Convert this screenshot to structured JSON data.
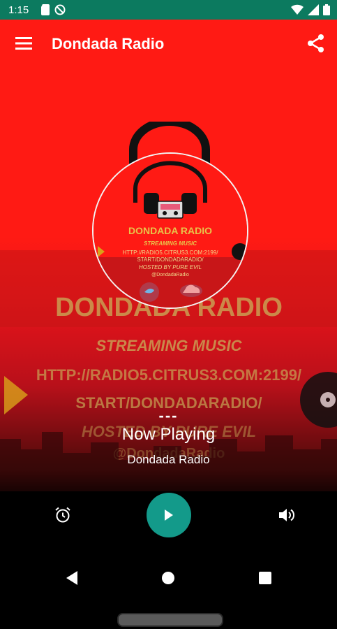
{
  "status_bar": {
    "time": "1:15",
    "icons": [
      "sd-card-icon",
      "no-disturb-icon",
      "wifi-icon",
      "signal-icon",
      "battery-icon"
    ]
  },
  "app_bar": {
    "title": "Dondada Radio",
    "menu_icon": "hamburger-menu-icon",
    "share_icon": "share-icon"
  },
  "artwork": {
    "disc_title": "DONDADA RADIO",
    "disc_subtitle": "STREAMING MUSIC",
    "disc_url_1": "HTTP://RADIO5.CITRUS3.COM:2199/",
    "disc_url_2": "START/DONDADARADIO/",
    "disc_hosted": "HOSTED BY PURE EVIL",
    "disc_handle": "@DondadaRadio",
    "bg_title": "DONDADA RADIO",
    "bg_subtitle": "STREAMING MUSIC",
    "bg_url_1": "HTTP://RADIO5.CITRUS3.COM:2199/",
    "bg_url_2": "START/DONDADARADIO/",
    "bg_hosted": "HOSTED BY PURE EVIL",
    "bg_handle": "@DondadaRadio"
  },
  "now_playing": {
    "dashes": "---",
    "label": "Now Playing",
    "station": "Dondada Radio"
  },
  "controls": {
    "alarm_icon": "alarm-clock-icon",
    "play_icon": "play-icon",
    "volume_icon": "volume-icon"
  },
  "nav": {
    "back_icon": "back-triangle-icon",
    "home_icon": "home-circle-icon",
    "recents_icon": "recents-square-icon"
  },
  "colors": {
    "status_bar": "#0c7a5f",
    "app_bar": "#ff1a14",
    "play_button": "#139a8a",
    "poster_gold": "#c9b05a"
  }
}
